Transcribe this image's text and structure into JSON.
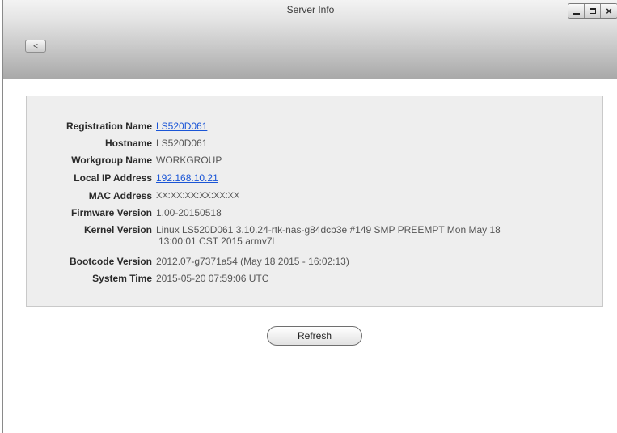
{
  "window": {
    "title": "Server Info",
    "back_label": "<"
  },
  "info": {
    "rows": [
      {
        "label": "Registration Name",
        "value": "LS520D061",
        "link": true
      },
      {
        "label": "Hostname",
        "value": "LS520D061",
        "link": false
      },
      {
        "label": "Workgroup Name",
        "value": "WORKGROUP",
        "link": false
      },
      {
        "label": "Local IP Address",
        "value": "192.168.10.21",
        "link": true
      },
      {
        "label": "MAC Address",
        "value": "XX:XX:XX:XX:XX:XX",
        "link": false
      },
      {
        "label": "Firmware Version",
        "value": "1.00-20150518",
        "link": false
      },
      {
        "label": "Kernel Version",
        "value_line1": "Linux LS520D061 3.10.24-rtk-nas-g84dcb3e #149 SMP PREEMPT Mon May 18",
        "value_line2": "13:00:01 CST 2015 armv7l",
        "link": false
      },
      {
        "label": "Bootcode Version",
        "value": "2012.07-g7371a54 (May 18 2015 - 16:02:13)",
        "link": false
      },
      {
        "label": "System Time",
        "value": "2015-05-20 07:59:06 UTC",
        "link": false
      }
    ]
  },
  "actions": {
    "refresh_label": "Refresh"
  }
}
